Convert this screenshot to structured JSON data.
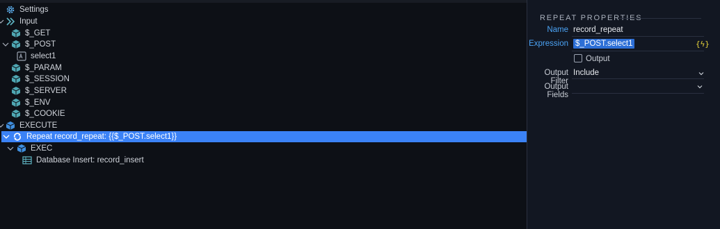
{
  "tree": {
    "settings": "Settings",
    "input": "Input",
    "get": "$_GET",
    "post": "$_POST",
    "select1": "select1",
    "param": "$_PARAM",
    "session": "$_SESSION",
    "server": "$_SERVER",
    "env": "$_ENV",
    "cookie": "$_COOKIE",
    "execute": "EXECUTE",
    "repeat": "Repeat record_repeat: {{$_POST.select1}}",
    "exec": "EXEC",
    "db_insert_prefix": "Database Insert: ",
    "db_insert_name": "record_insert"
  },
  "properties": {
    "title": "REPEAT PROPERTIES",
    "name_label": "Name",
    "name_value": "record_repeat",
    "expression_label": "Expression",
    "expression_value": "$_POST.select1",
    "expression_icon": "{ϟ}",
    "output_label": "Output",
    "output_checked": false,
    "output_filter_label": "Output Filter",
    "output_filter_value": "Include",
    "output_fields_label": "Output Fields",
    "output_fields_value": ""
  },
  "colors": {
    "selection": "#3b82f6",
    "link": "#4ba3f5",
    "icon_teal": "#5fb6c4",
    "input_accent": "#d7d04a"
  }
}
